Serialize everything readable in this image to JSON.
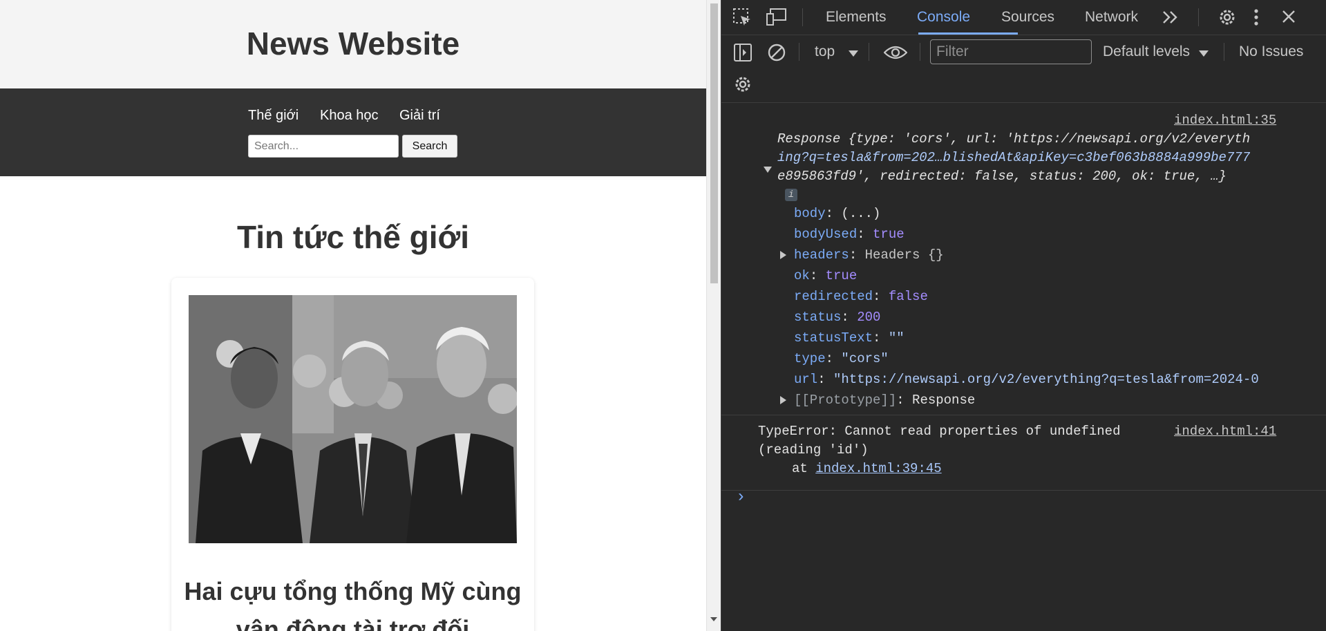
{
  "page": {
    "site_title": "News Website",
    "nav": [
      "Thế giới",
      "Khoa học",
      "Giải trí"
    ],
    "search": {
      "placeholder": "Search...",
      "button_label": "Search"
    },
    "section_title": "Tin tức thế giới",
    "card": {
      "title": "Hai cựu tổng thống Mỹ cùng vận động tài trợ đối"
    }
  },
  "devtools": {
    "tabs": [
      "Elements",
      "Console",
      "Sources",
      "Network"
    ],
    "active_tab": "Console",
    "toolbar": {
      "context": "top",
      "filter_placeholder": "Filter",
      "levels": "Default levels",
      "issues": "No Issues"
    },
    "log": {
      "source": "index.html:35",
      "summary_line1": "Response {type: 'cors', url: 'https://newsapi.org/v2/everyth",
      "summary_line2": "ing?q=tesla&from=202…blishedAt&apiKey=c3bef063b8884a999be777",
      "summary_line3": "e895863fd9', redirected: false, status: 200, ok: true, …}",
      "info_badge": "i",
      "props": [
        {
          "key": "body",
          "value": "(...)"
        },
        {
          "key": "bodyUsed",
          "value": "true"
        },
        {
          "key": "headers",
          "value": "Headers {}"
        },
        {
          "key": "ok",
          "value": "true"
        },
        {
          "key": "redirected",
          "value": "false"
        },
        {
          "key": "status",
          "value": "200"
        },
        {
          "key": "statusText",
          "value": "\"\""
        },
        {
          "key": "type",
          "value": "\"cors\""
        },
        {
          "key": "url",
          "value": "\"https://newsapi.org/v2/everything?q=tesla&from=2024-0"
        },
        {
          "key": "[[Prototype]]",
          "value": "Response"
        }
      ]
    },
    "error": {
      "line1": "TypeError: Cannot read properties of undefined",
      "line2": "(reading 'id')",
      "at_prefix": "at ",
      "at_link": "index.html:39:45",
      "source": "index.html:41"
    },
    "prompt": "›"
  },
  "colors": {
    "header_bg": "#f4f4f4",
    "nav_bg": "#333333",
    "devtools_bg": "#282828",
    "accent": "#7cacf8"
  }
}
